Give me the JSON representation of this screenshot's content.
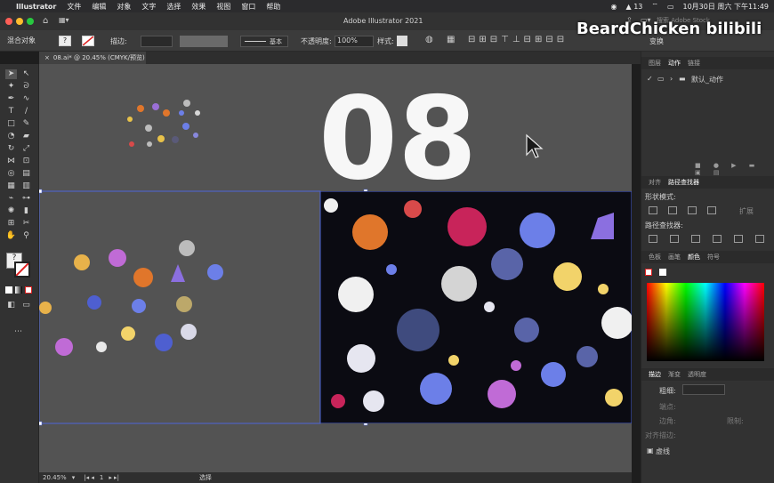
{
  "menubar": {
    "items": [
      "Illustrator",
      "文件",
      "编辑",
      "对象",
      "文字",
      "选择",
      "效果",
      "视图",
      "窗口",
      "帮助"
    ],
    "notif_count": "13",
    "datetime": "10月30日 周六 下午11:49"
  },
  "titlebar": {
    "title": "Adobe Illustrator 2021",
    "search_placeholder": "搜索 Adobe Stock"
  },
  "controlbar": {
    "selection_label": "混合对象",
    "stroke_label": "描边:",
    "brush_label": "基本",
    "opacity_label": "不透明度:",
    "opacity_value": "100%",
    "style_label": "样式:",
    "transform_label": "变换"
  },
  "document_tab": {
    "label": "08.ai* @ 20.45% (CMYK/预览)"
  },
  "canvas": {
    "heading_text": "08",
    "scatter_colors": [
      "#e0762b",
      "#9a6fd6",
      "#6c7fe8",
      "#bcbcbc",
      "#e8c24a",
      "#d84a4a",
      "#dba1e8"
    ]
  },
  "statusbar": {
    "zoom": "20.45%",
    "page": "1",
    "tool": "选择"
  },
  "panels": {
    "top_tabs": [
      "图层",
      "动作",
      "链接"
    ],
    "action_set": "默认_动作",
    "pathfinder_tabs": [
      "对齐",
      "路径查找器"
    ],
    "shape_modes_label": "形状模式:",
    "expand_label": "扩展",
    "pathfinders_label": "路径查找器:",
    "color_tabs": [
      "色板",
      "画笔",
      "颜色",
      "符号"
    ],
    "stroke_tabs": [
      "描边",
      "渐变",
      "透明度"
    ],
    "weight_label": "粗细:",
    "endpoint_label": "端点:",
    "corner_label": "边角:",
    "limit_label": "限制:",
    "align_stroke_label": "对齐描边:",
    "dashed_label": "虚线"
  },
  "watermark": {
    "text": "BeardChicken bilibili"
  }
}
